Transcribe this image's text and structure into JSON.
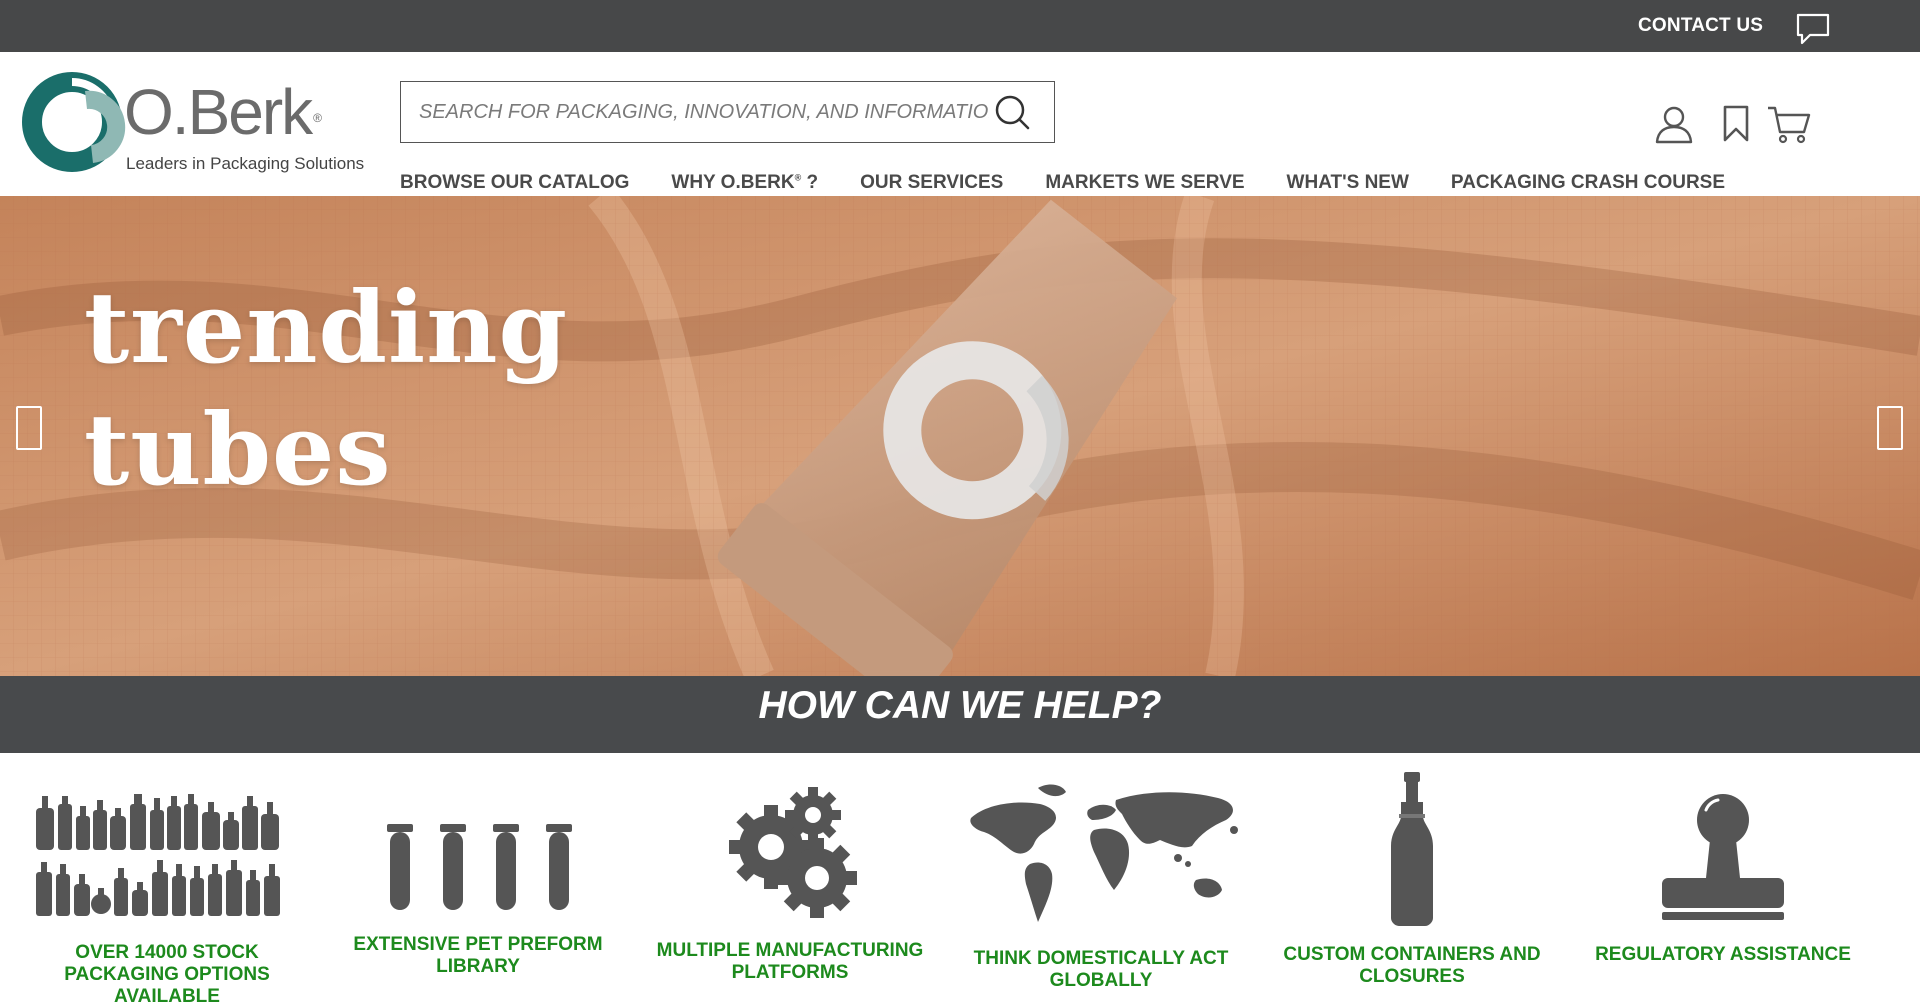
{
  "topbar": {
    "contact_label": "CONTACT US"
  },
  "brand": {
    "name": "O.Berk",
    "registered": "®",
    "tagline": "Leaders in Packaging Solutions"
  },
  "search": {
    "placeholder": "SEARCH FOR PACKAGING, INNOVATION, AND INFORMATION"
  },
  "header_icons": [
    "user-icon",
    "bookmark-icon",
    "cart-icon"
  ],
  "nav": {
    "items": [
      {
        "label": "BROWSE OUR CATALOG"
      },
      {
        "label": "WHY O.BERK",
        "sup": "®",
        "suffix": " ?"
      },
      {
        "label": "OUR SERVICES"
      },
      {
        "label": "MARKETS WE SERVE"
      },
      {
        "label": "WHAT'S NEW"
      },
      {
        "label": "PACKAGING CRASH COURSE"
      }
    ]
  },
  "hero": {
    "line1": "trending",
    "line2": "tubes"
  },
  "help": {
    "title": "HOW CAN WE HELP?"
  },
  "features": [
    {
      "label": "OVER 14000 STOCK PACKAGING OPTIONS AVAILABLE",
      "icon": "bottles-icon"
    },
    {
      "label": "EXTENSIVE PET PREFORM LIBRARY",
      "icon": "preforms-icon"
    },
    {
      "label": "MULTIPLE MANUFACTURING PLATFORMS",
      "icon": "gears-icon"
    },
    {
      "label": "THINK DOMESTICALLY ACT GLOBALLY",
      "icon": "world-map-icon"
    },
    {
      "label": "CUSTOM CONTAINERS AND CLOSURES",
      "icon": "custom-bottle-icon"
    },
    {
      "label": "REGULATORY ASSISTANCE",
      "icon": "stamp-icon"
    }
  ],
  "colors": {
    "topbar": "#474849",
    "accent_green": "#1d8a1d",
    "logo_teal": "#1a6e6a",
    "logo_light": "#8fb8b4"
  }
}
